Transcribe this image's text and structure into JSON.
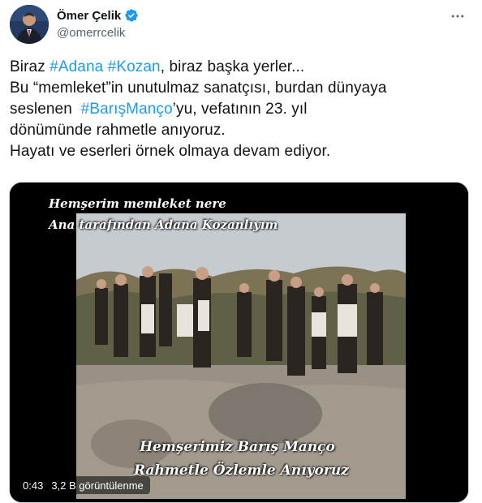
{
  "author": {
    "name": "Ömer Çelik",
    "handle": "@omerrcelik",
    "verified": true
  },
  "icons": {
    "verified": "verified-badge-icon",
    "more": "more-options-icon"
  },
  "tweet": {
    "line1": {
      "t1": "Biraz ",
      "h1": "#Adana",
      "t2": " ",
      "h2": "#Kozan",
      "t3": ", biraz başka yerler..."
    },
    "line2": "Bu “memleket”in unutulmaz sanatçısı, burdan dünyaya",
    "line3": {
      "t1": "seslenen  ",
      "h1": "#BarışManço",
      "t2": "’yu, vefatının 23. yıl"
    },
    "line4": "dönümünde rahmetle anıyoruz.",
    "line5": "Hayatı ve eserleri örnek olmaya devam ediyor."
  },
  "video": {
    "captions": [
      "Hemşerim memleket nere",
      "Ana tarafından Adana Kozanlıyım",
      "Hemşerimiz Barış Manço",
      "Rahmetle Özlemle Anıyoruz"
    ],
    "duration": "0:43",
    "views": "3,2 B görüntülenme"
  },
  "colors": {
    "text": "#0f1419",
    "secondary": "#536471",
    "accent": "#1d9bf0"
  }
}
